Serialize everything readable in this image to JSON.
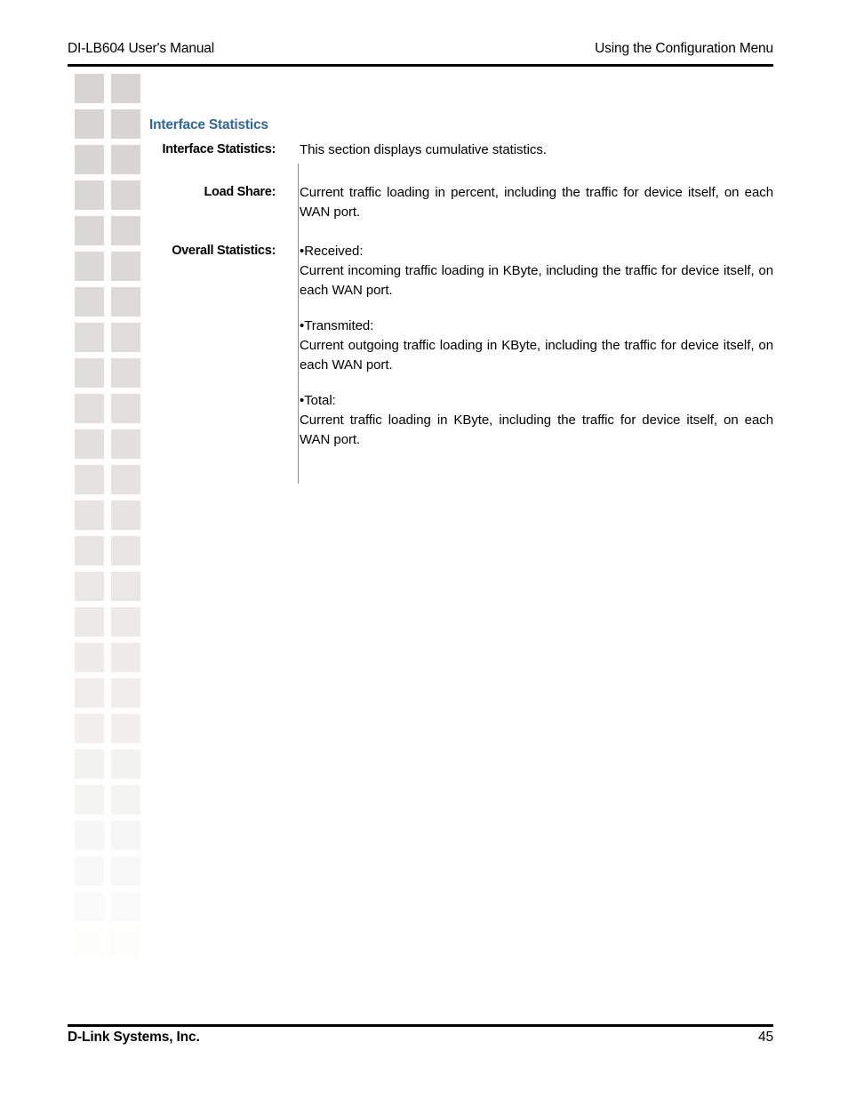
{
  "header": {
    "left": "DI-LB604 User's Manual",
    "right": "Using the Configuration Menu"
  },
  "footer": {
    "left": "D-Link Systems, Inc.",
    "page_number": "45"
  },
  "section": {
    "title": "Interface Statistics",
    "rows": [
      {
        "label": "Interface Statistics:",
        "paragraphs": [
          "This section displays cumulative statistics."
        ]
      },
      {
        "label": "Load Share:",
        "paragraphs": [
          "Current traffic loading in percent, including the traffic for device itself, on each WAN port."
        ]
      },
      {
        "label": "Overall Statistics:",
        "bullets": [
          {
            "title": "•Received:",
            "text": "Current incoming traffic loading in KByte, including the traffic for device itself, on each WAN port."
          },
          {
            "title": "•Transmited:",
            "text": "Current outgoing traffic loading in KByte, including the traffic for device itself, on each WAN port."
          },
          {
            "title": "•Total:",
            "text": "Current traffic loading in KByte, including the traffic for device itself, on each WAN port."
          }
        ]
      }
    ]
  },
  "decoration": {
    "square_color": "#d7d5d3",
    "columns": 2,
    "rows": 27
  },
  "colors": {
    "heading_blue": "#31679b",
    "rule_black": "#000000",
    "divider_gray": "#8c8c8c"
  }
}
